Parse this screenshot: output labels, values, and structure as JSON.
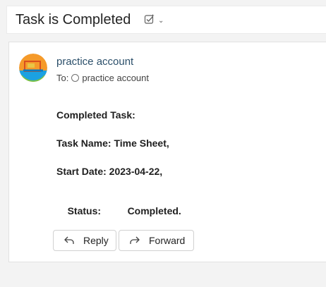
{
  "email": {
    "subject": "Task is Completed",
    "sender": "practice account",
    "to_label": "To:",
    "recipient": "practice account",
    "body": {
      "line1": "Completed Task:",
      "line2": "Task Name: Time Sheet,",
      "line3": "Start Date: 2023-04-22,",
      "line4_label": "Status:",
      "line4_value": "Completed."
    },
    "actions": {
      "reply_label": "Reply",
      "forward_label": "Forward"
    }
  },
  "icons": {
    "summary": "task-summary-icon",
    "dropdown": "chevron-down-icon",
    "avatar": "account-avatar-icon",
    "recipient_status": "presence-circle-icon",
    "reply": "reply-arrow-icon",
    "forward": "forward-arrow-icon"
  },
  "colors": {
    "sender": "#2b4f6a",
    "avatar_orange": "#f59a2a",
    "avatar_green": "#7cc242",
    "avatar_blue": "#1ba1e2"
  }
}
